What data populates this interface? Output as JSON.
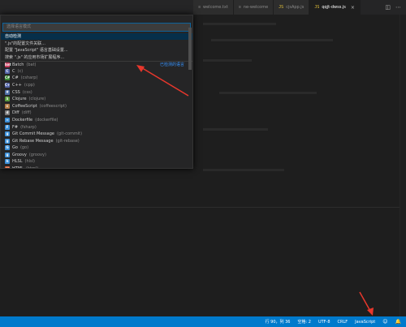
{
  "tabs": [
    {
      "icon": "≡",
      "label": "welcome.txt",
      "active": false
    },
    {
      "icon": "≡",
      "label": "ne-welcome",
      "active": false
    },
    {
      "icon": "JS",
      "label": "cjsApp.js",
      "active": false
    },
    {
      "icon": "JS",
      "label": "qqjt-dwss.js",
      "active": true
    }
  ],
  "tab_close": "×",
  "picker": {
    "placeholder": "选择语言模式",
    "items": [
      {
        "label": "自动检测",
        "desc": "",
        "right": "",
        "icon": "",
        "color": "",
        "selected": true
      },
      {
        "label": "\".js\"的配置文件关联...",
        "desc": "",
        "right": "",
        "icon": "",
        "color": "",
        "selected": false
      },
      {
        "label": "配置 \"JavaScript\" 语言基础设置...",
        "desc": "",
        "right": "",
        "icon": "",
        "color": "",
        "selected": false
      },
      {
        "label": "搜索 \".js\" 的应用市场扩展程序...",
        "desc": "",
        "right": "",
        "icon": "",
        "color": "",
        "selected": false
      },
      {
        "label": "Batch",
        "desc": "(bat)",
        "right": "已检测的语言",
        "icon": "bat",
        "color": "#c63b5d",
        "selected": false,
        "sep": true
      },
      {
        "label": "C",
        "desc": "(c)",
        "right": "",
        "icon": "C",
        "color": "#5566aa",
        "selected": false
      },
      {
        "label": "C#",
        "desc": "(csharp)",
        "right": "",
        "icon": "C#",
        "color": "#368832",
        "selected": false
      },
      {
        "label": "C++",
        "desc": "(cpp)",
        "right": "",
        "icon": "C+",
        "color": "#5566aa",
        "selected": false
      },
      {
        "label": "CSS",
        "desc": "(css)",
        "right": "",
        "icon": "#",
        "color": "#4d6fa8",
        "selected": false
      },
      {
        "label": "Clojure",
        "desc": "(clojure)",
        "right": "",
        "icon": "λ",
        "color": "#5a9a3e",
        "selected": false
      },
      {
        "label": "CoffeeScript",
        "desc": "(coffeescript)",
        "right": "",
        "icon": "c",
        "color": "#b5804a",
        "selected": false
      },
      {
        "label": "Diff",
        "desc": "(diff)",
        "right": "",
        "icon": "d",
        "color": "#7a7a7a",
        "selected": false
      },
      {
        "label": "Dockerfile",
        "desc": "(dockerfile)",
        "right": "",
        "icon": "≈",
        "color": "#3b8fd8",
        "selected": false
      },
      {
        "label": "F#",
        "desc": "(fsharp)",
        "right": "",
        "icon": "F",
        "color": "#3b8fd8",
        "selected": false
      },
      {
        "label": "Git Commit Message",
        "desc": "(git-commit)",
        "right": "",
        "icon": "g",
        "color": "#3b8fd8",
        "selected": false
      },
      {
        "label": "Git Rebase Message",
        "desc": "(git-rebase)",
        "right": "",
        "icon": "g",
        "color": "#3b8fd8",
        "selected": false
      },
      {
        "label": "Go",
        "desc": "(go)",
        "right": "",
        "icon": "G",
        "color": "#3b8fd8",
        "selected": false
      },
      {
        "label": "Groovy",
        "desc": "(groovy)",
        "right": "",
        "icon": "g",
        "color": "#3b8fd8",
        "selected": false
      },
      {
        "label": "HLSL",
        "desc": "(hlsl)",
        "right": "",
        "icon": "h",
        "color": "#3b8fd8",
        "selected": false
      },
      {
        "label": "HTML",
        "desc": "(html)",
        "right": "",
        "icon": "<>",
        "color": "#d9643a",
        "selected": false
      }
    ]
  },
  "status": {
    "position": "行 90，列 36",
    "spaces": "空格: 2",
    "encoding": "UTF-8",
    "eol": "CRLF",
    "language": "JavaScript"
  },
  "colors": {
    "accent": "#007acc",
    "arrow": "#e8372c"
  }
}
